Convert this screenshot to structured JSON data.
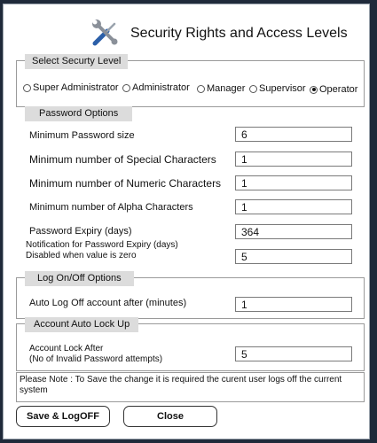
{
  "window": {
    "title": "Security Rights and Access Levels"
  },
  "security_level": {
    "legend": "Select Securty Level",
    "options": [
      "Super Administrator",
      "Administrator",
      "Manager",
      "Supervisor",
      "Operator"
    ],
    "selected": "Operator"
  },
  "password_options": {
    "legend": "Password Options",
    "min_size": {
      "label": "Minimum Password size",
      "value": "6"
    },
    "min_special": {
      "label": "Minimum number of Special Characters",
      "value": "1"
    },
    "min_numeric": {
      "label": "Minimum number of Numeric Characters",
      "value": "1"
    },
    "min_alpha": {
      "label": "Minimum number of Alpha Characters",
      "value": "1"
    },
    "expiry": {
      "label": "Password Expiry (days)",
      "value": "364"
    },
    "notification": {
      "label_line1": "Notification for Password Expiry (days)",
      "label_line2": "Disabled when value is zero",
      "value": "5"
    }
  },
  "logon_options": {
    "legend": "Log On/Off Options",
    "auto_logoff": {
      "label": "Auto Log Off account after (minutes)",
      "value": "1"
    }
  },
  "auto_lock": {
    "legend": "Account Auto Lock Up",
    "lock_after": {
      "label_line1": "Account Lock After",
      "label_line2": "(No of Invalid Password attempts)",
      "value": "5"
    }
  },
  "note": "Please Note : To Save the change it is required the curent user logs off the current system",
  "buttons": {
    "save": "Save & LogOFF",
    "close": "Close"
  },
  "icons": {
    "title": "tools-icon"
  }
}
